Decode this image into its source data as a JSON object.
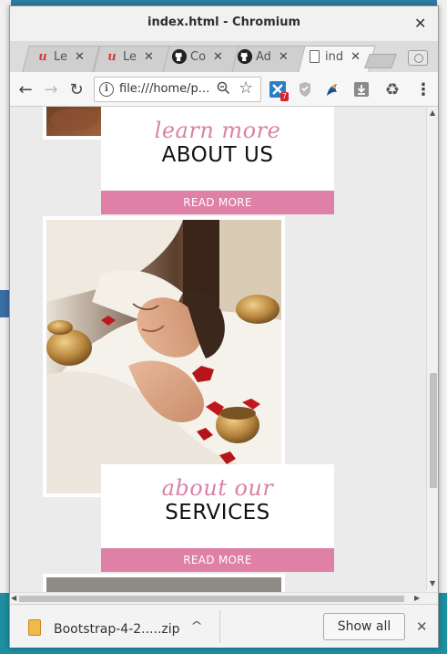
{
  "window": {
    "title": "index.html - Chromium",
    "close_glyph": "✕"
  },
  "tabs": [
    {
      "label": "Le",
      "icon": "u-icon",
      "icon_glyph": "u",
      "close": "✕"
    },
    {
      "label": "Le",
      "icon": "u-icon",
      "icon_glyph": "u",
      "close": "✕"
    },
    {
      "label": "Co",
      "icon": "github-icon",
      "icon_glyph": "●",
      "close": "✕"
    },
    {
      "label": "Ad",
      "icon": "github-icon",
      "icon_glyph": "●",
      "close": "✕"
    },
    {
      "label": "ind",
      "icon": "document-icon",
      "active": true,
      "close": "✕"
    }
  ],
  "toolbar": {
    "back_glyph": "←",
    "forward_glyph": "→",
    "reload_glyph": "↻",
    "url": "file:///home/p...",
    "info_glyph": "i",
    "zoom_glyph": "🔍",
    "star_glyph": "☆",
    "menu_glyph": "⋮"
  },
  "extensions": [
    {
      "name": "extension-x-icon",
      "badge": "7"
    },
    {
      "name": "shield-icon"
    },
    {
      "name": "blue-extension-icon"
    },
    {
      "name": "download-extension-icon"
    },
    {
      "name": "recycle-icon",
      "glyph": "♻"
    }
  ],
  "page": {
    "cards": [
      {
        "script": "learn more",
        "heading": "ABOUT US",
        "button": "READ MORE"
      },
      {
        "script": "about our",
        "heading": "SERVICES",
        "button": "READ MORE"
      }
    ],
    "image_alt": "Woman relaxing during a spa treatment with singing bowls and rose petals"
  },
  "download": {
    "filename": "Bootstrap-4-2.....zip",
    "caret": "^",
    "show_all": "Show all",
    "close_glyph": "✕"
  },
  "colors": {
    "accent_pink": "#df80a6",
    "script_pink": "#d982a6"
  }
}
